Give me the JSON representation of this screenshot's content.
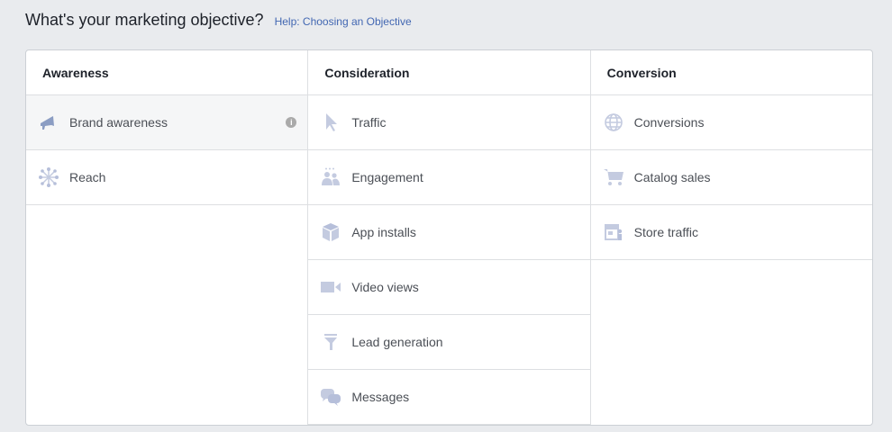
{
  "header": {
    "title": "What's your marketing objective?",
    "help_link": "Help: Choosing an Objective"
  },
  "colors": {
    "icon": "#c4cbe0",
    "icon_selected": "#8b9dc3",
    "link": "#4267b2"
  },
  "columns": [
    {
      "title": "Awareness",
      "items": [
        {
          "label": "Brand awareness",
          "icon": "megaphone-icon",
          "selected": true
        },
        {
          "label": "Reach",
          "icon": "reach-icon"
        }
      ]
    },
    {
      "title": "Consideration",
      "items": [
        {
          "label": "Traffic",
          "icon": "cursor-icon"
        },
        {
          "label": "Engagement",
          "icon": "people-icon"
        },
        {
          "label": "App installs",
          "icon": "box-icon"
        },
        {
          "label": "Video views",
          "icon": "video-camera-icon"
        },
        {
          "label": "Lead generation",
          "icon": "funnel-icon"
        },
        {
          "label": "Messages",
          "icon": "chat-bubbles-icon"
        }
      ]
    },
    {
      "title": "Conversion",
      "items": [
        {
          "label": "Conversions",
          "icon": "globe-icon"
        },
        {
          "label": "Catalog sales",
          "icon": "cart-icon"
        },
        {
          "label": "Store traffic",
          "icon": "store-icon"
        }
      ]
    }
  ]
}
